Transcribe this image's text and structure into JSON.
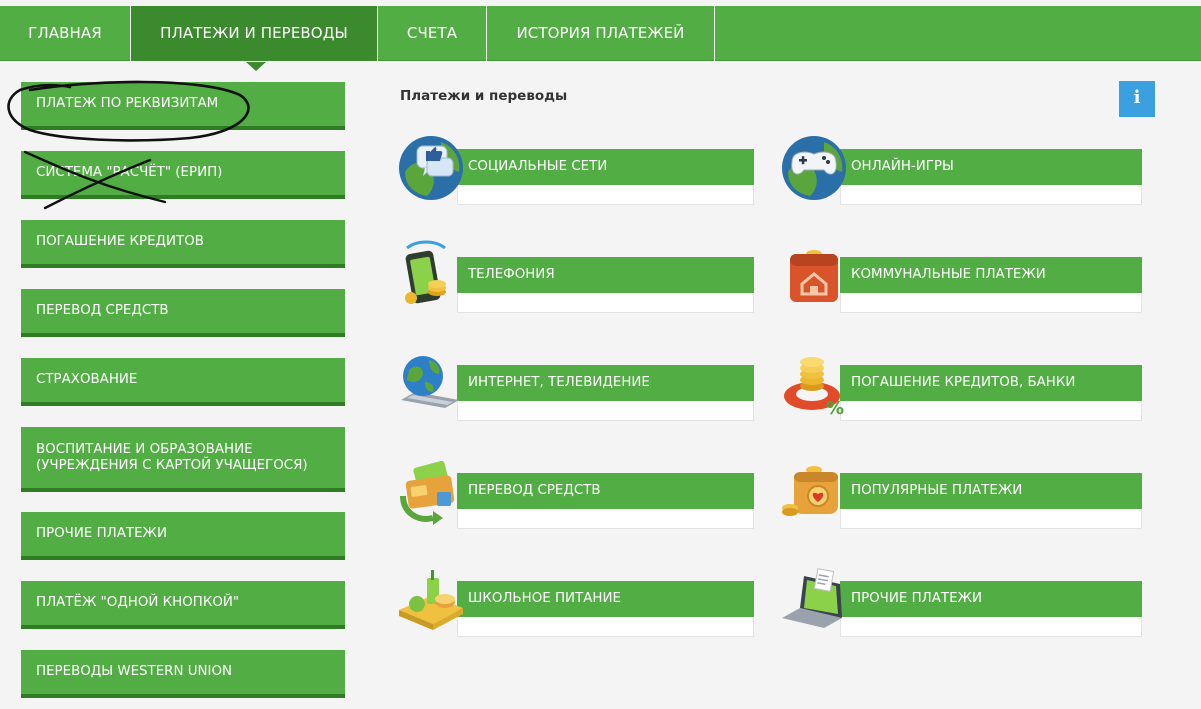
{
  "topnav": {
    "tabs": [
      {
        "label": "ГЛАВНАЯ",
        "active": false
      },
      {
        "label": "ПЛАТЕЖИ И ПЕРЕВОДЫ",
        "active": true
      },
      {
        "label": "СЧЕТА",
        "active": false
      },
      {
        "label": "ИСТОРИЯ ПЛАТЕЖЕЙ",
        "active": false
      }
    ]
  },
  "sidebar": {
    "items": [
      {
        "label": "ПЛАТЕЖ ПО РЕКВИЗИТАМ"
      },
      {
        "label": "СИСТЕМА \"РАСЧЁТ\" (ЕРИП)"
      },
      {
        "label": "ПОГАШЕНИЕ КРЕДИТОВ"
      },
      {
        "label": "ПЕРЕВОД СРЕДСТВ"
      },
      {
        "label": "СТРАХОВАНИЕ"
      },
      {
        "label": "ВОСПИТАНИЕ И ОБРАЗОВАНИЕ (УЧРЕЖДЕНИЯ С КАРТОЙ УЧАЩЕГОСЯ)"
      },
      {
        "label": "ПРОЧИЕ ПЛАТЕЖИ"
      },
      {
        "label": "ПЛАТЁЖ \"ОДНОЙ КНОПКОЙ\""
      },
      {
        "label": "ПЕРЕВОДЫ WESTERN UNION"
      }
    ]
  },
  "main": {
    "title": "Платежи и переводы",
    "info_label": "i",
    "categories": [
      {
        "label": "СОЦИАЛЬНЫЕ СЕТИ",
        "icon": "social-networks-icon"
      },
      {
        "label": "ОНЛАЙН-ИГРЫ",
        "icon": "online-games-icon"
      },
      {
        "label": "ТЕЛЕФОНИЯ",
        "icon": "telephony-icon"
      },
      {
        "label": "КОММУНАЛЬНЫЕ ПЛАТЕЖИ",
        "icon": "utility-payments-icon"
      },
      {
        "label": "ИНТЕРНЕТ, ТЕЛЕВИДЕНИЕ",
        "icon": "internet-tv-icon"
      },
      {
        "label": "ПОГАШЕНИЕ КРЕДИТОВ, БАНКИ",
        "icon": "loans-banks-icon"
      },
      {
        "label": "ПЕРЕВОД СРЕДСТВ",
        "icon": "money-transfer-icon"
      },
      {
        "label": "ПОПУЛЯРНЫЕ ПЛАТЕЖИ",
        "icon": "popular-payments-icon"
      },
      {
        "label": "ШКОЛЬНОЕ ПИТАНИЕ",
        "icon": "school-meals-icon"
      },
      {
        "label": "ПРОЧИЕ ПЛАТЕЖИ",
        "icon": "other-payments-icon"
      }
    ]
  },
  "colors": {
    "brand_green": "#52ae44",
    "dark_green": "#2e7d22",
    "info_blue": "#3aa0df",
    "background": "#f4f4f4"
  }
}
